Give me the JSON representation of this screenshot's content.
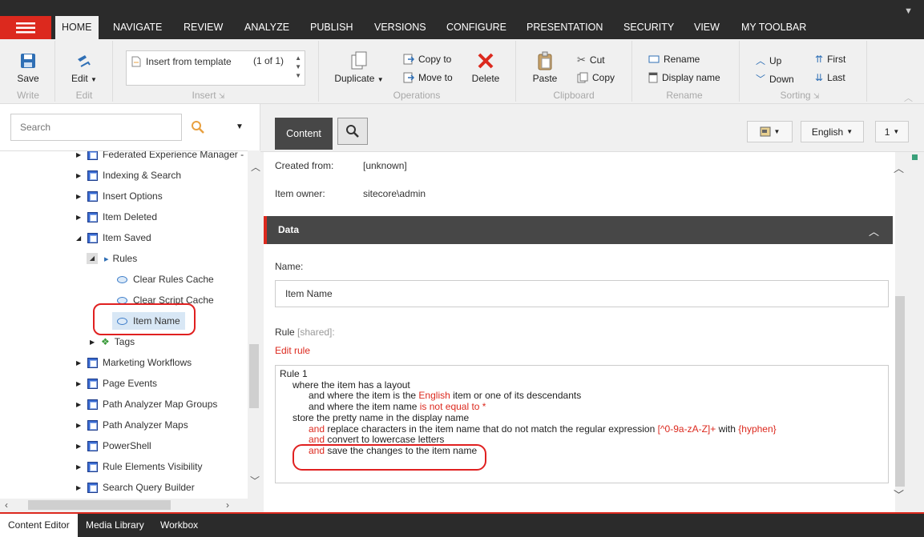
{
  "menu": {
    "tabs": [
      "HOME",
      "NAVIGATE",
      "REVIEW",
      "ANALYZE",
      "PUBLISH",
      "VERSIONS",
      "CONFIGURE",
      "PRESENTATION",
      "SECURITY",
      "VIEW",
      "MY TOOLBAR"
    ],
    "active_tab": "HOME"
  },
  "ribbon": {
    "write": {
      "group": "Write",
      "save": "Save"
    },
    "edit": {
      "group": "Edit",
      "edit": "Edit"
    },
    "insert": {
      "group": "Insert",
      "item": "Insert from template",
      "count": "(1 of 1)"
    },
    "operations": {
      "group": "Operations",
      "duplicate": "Duplicate",
      "copy_to": "Copy to",
      "move_to": "Move to",
      "delete": "Delete"
    },
    "clipboard": {
      "group": "Clipboard",
      "paste": "Paste",
      "cut": "Cut",
      "copy": "Copy"
    },
    "rename": {
      "group": "Rename",
      "rename": "Rename",
      "display_name": "Display name"
    },
    "sorting": {
      "group": "Sorting",
      "up": "Up",
      "down": "Down",
      "first": "First",
      "last": "Last"
    }
  },
  "search": {
    "placeholder": "Search"
  },
  "tree": {
    "items": [
      {
        "label": "Federated Experience Manager -"
      },
      {
        "label": "Indexing & Search"
      },
      {
        "label": "Insert Options"
      },
      {
        "label": "Item Deleted"
      },
      {
        "label": "Item Saved"
      },
      {
        "label": "Rules"
      },
      {
        "label": "Clear Rules Cache"
      },
      {
        "label": "Clear Script Cache"
      },
      {
        "label": "Item Name"
      },
      {
        "label": "Tags"
      },
      {
        "label": "Marketing Workflows"
      },
      {
        "label": "Page Events"
      },
      {
        "label": "Path Analyzer Map Groups"
      },
      {
        "label": "Path Analyzer Maps"
      },
      {
        "label": "PowerShell"
      },
      {
        "label": "Rule Elements Visibility"
      },
      {
        "label": "Search Query Builder"
      }
    ]
  },
  "editor": {
    "tab_content": "Content",
    "version_dropdown": "1",
    "language_dropdown": "English",
    "created_from_label": "Created from:",
    "created_from_value": "[unknown]",
    "owner_label": "Item owner:",
    "owner_value": "sitecore\\admin",
    "section_title": "Data",
    "name_label": "Name:",
    "name_value": "Item Name",
    "rule_label": "Rule",
    "rule_shared": "[shared]:",
    "edit_rule": "Edit rule",
    "rule": {
      "title": "Rule 1",
      "l1": "where the item has a layout",
      "l2a": "and where the item is the ",
      "l2b": "English",
      "l2c": " item or one of its descendants",
      "l3a": "and where the item name ",
      "l3b": "is not equal to *",
      "l4": "store the pretty name in the display name",
      "l5a": "and",
      "l5b": " replace characters in the item name that do not match the regular expression ",
      "l5c": "[^0-9a-zA-Z]+",
      "l5d": " with ",
      "l5e": "{hyphen}",
      "l6a": "and",
      "l6b": " convert to lowercase letters",
      "l7a": "and",
      "l7b": " save the changes to the item name"
    }
  },
  "bottom_tabs": [
    "Content Editor",
    "Media Library",
    "Workbox"
  ],
  "colors": {
    "accent": "#dc291e",
    "dark": "#2b2b2b"
  }
}
